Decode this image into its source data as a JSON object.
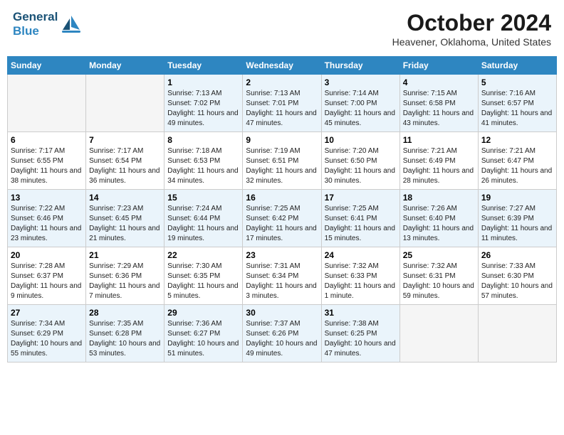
{
  "header": {
    "logo_line1": "General",
    "logo_line2": "Blue",
    "month": "October 2024",
    "location": "Heavener, Oklahoma, United States"
  },
  "days_of_week": [
    "Sunday",
    "Monday",
    "Tuesday",
    "Wednesday",
    "Thursday",
    "Friday",
    "Saturday"
  ],
  "weeks": [
    [
      {
        "day": "",
        "sunrise": "",
        "sunset": "",
        "daylight": ""
      },
      {
        "day": "",
        "sunrise": "",
        "sunset": "",
        "daylight": ""
      },
      {
        "day": "1",
        "sunrise": "Sunrise: 7:13 AM",
        "sunset": "Sunset: 7:02 PM",
        "daylight": "Daylight: 11 hours and 49 minutes."
      },
      {
        "day": "2",
        "sunrise": "Sunrise: 7:13 AM",
        "sunset": "Sunset: 7:01 PM",
        "daylight": "Daylight: 11 hours and 47 minutes."
      },
      {
        "day": "3",
        "sunrise": "Sunrise: 7:14 AM",
        "sunset": "Sunset: 7:00 PM",
        "daylight": "Daylight: 11 hours and 45 minutes."
      },
      {
        "day": "4",
        "sunrise": "Sunrise: 7:15 AM",
        "sunset": "Sunset: 6:58 PM",
        "daylight": "Daylight: 11 hours and 43 minutes."
      },
      {
        "day": "5",
        "sunrise": "Sunrise: 7:16 AM",
        "sunset": "Sunset: 6:57 PM",
        "daylight": "Daylight: 11 hours and 41 minutes."
      }
    ],
    [
      {
        "day": "6",
        "sunrise": "Sunrise: 7:17 AM",
        "sunset": "Sunset: 6:55 PM",
        "daylight": "Daylight: 11 hours and 38 minutes."
      },
      {
        "day": "7",
        "sunrise": "Sunrise: 7:17 AM",
        "sunset": "Sunset: 6:54 PM",
        "daylight": "Daylight: 11 hours and 36 minutes."
      },
      {
        "day": "8",
        "sunrise": "Sunrise: 7:18 AM",
        "sunset": "Sunset: 6:53 PM",
        "daylight": "Daylight: 11 hours and 34 minutes."
      },
      {
        "day": "9",
        "sunrise": "Sunrise: 7:19 AM",
        "sunset": "Sunset: 6:51 PM",
        "daylight": "Daylight: 11 hours and 32 minutes."
      },
      {
        "day": "10",
        "sunrise": "Sunrise: 7:20 AM",
        "sunset": "Sunset: 6:50 PM",
        "daylight": "Daylight: 11 hours and 30 minutes."
      },
      {
        "day": "11",
        "sunrise": "Sunrise: 7:21 AM",
        "sunset": "Sunset: 6:49 PM",
        "daylight": "Daylight: 11 hours and 28 minutes."
      },
      {
        "day": "12",
        "sunrise": "Sunrise: 7:21 AM",
        "sunset": "Sunset: 6:47 PM",
        "daylight": "Daylight: 11 hours and 26 minutes."
      }
    ],
    [
      {
        "day": "13",
        "sunrise": "Sunrise: 7:22 AM",
        "sunset": "Sunset: 6:46 PM",
        "daylight": "Daylight: 11 hours and 23 minutes."
      },
      {
        "day": "14",
        "sunrise": "Sunrise: 7:23 AM",
        "sunset": "Sunset: 6:45 PM",
        "daylight": "Daylight: 11 hours and 21 minutes."
      },
      {
        "day": "15",
        "sunrise": "Sunrise: 7:24 AM",
        "sunset": "Sunset: 6:44 PM",
        "daylight": "Daylight: 11 hours and 19 minutes."
      },
      {
        "day": "16",
        "sunrise": "Sunrise: 7:25 AM",
        "sunset": "Sunset: 6:42 PM",
        "daylight": "Daylight: 11 hours and 17 minutes."
      },
      {
        "day": "17",
        "sunrise": "Sunrise: 7:25 AM",
        "sunset": "Sunset: 6:41 PM",
        "daylight": "Daylight: 11 hours and 15 minutes."
      },
      {
        "day": "18",
        "sunrise": "Sunrise: 7:26 AM",
        "sunset": "Sunset: 6:40 PM",
        "daylight": "Daylight: 11 hours and 13 minutes."
      },
      {
        "day": "19",
        "sunrise": "Sunrise: 7:27 AM",
        "sunset": "Sunset: 6:39 PM",
        "daylight": "Daylight: 11 hours and 11 minutes."
      }
    ],
    [
      {
        "day": "20",
        "sunrise": "Sunrise: 7:28 AM",
        "sunset": "Sunset: 6:37 PM",
        "daylight": "Daylight: 11 hours and 9 minutes."
      },
      {
        "day": "21",
        "sunrise": "Sunrise: 7:29 AM",
        "sunset": "Sunset: 6:36 PM",
        "daylight": "Daylight: 11 hours and 7 minutes."
      },
      {
        "day": "22",
        "sunrise": "Sunrise: 7:30 AM",
        "sunset": "Sunset: 6:35 PM",
        "daylight": "Daylight: 11 hours and 5 minutes."
      },
      {
        "day": "23",
        "sunrise": "Sunrise: 7:31 AM",
        "sunset": "Sunset: 6:34 PM",
        "daylight": "Daylight: 11 hours and 3 minutes."
      },
      {
        "day": "24",
        "sunrise": "Sunrise: 7:32 AM",
        "sunset": "Sunset: 6:33 PM",
        "daylight": "Daylight: 11 hours and 1 minute."
      },
      {
        "day": "25",
        "sunrise": "Sunrise: 7:32 AM",
        "sunset": "Sunset: 6:31 PM",
        "daylight": "Daylight: 10 hours and 59 minutes."
      },
      {
        "day": "26",
        "sunrise": "Sunrise: 7:33 AM",
        "sunset": "Sunset: 6:30 PM",
        "daylight": "Daylight: 10 hours and 57 minutes."
      }
    ],
    [
      {
        "day": "27",
        "sunrise": "Sunrise: 7:34 AM",
        "sunset": "Sunset: 6:29 PM",
        "daylight": "Daylight: 10 hours and 55 minutes."
      },
      {
        "day": "28",
        "sunrise": "Sunrise: 7:35 AM",
        "sunset": "Sunset: 6:28 PM",
        "daylight": "Daylight: 10 hours and 53 minutes."
      },
      {
        "day": "29",
        "sunrise": "Sunrise: 7:36 AM",
        "sunset": "Sunset: 6:27 PM",
        "daylight": "Daylight: 10 hours and 51 minutes."
      },
      {
        "day": "30",
        "sunrise": "Sunrise: 7:37 AM",
        "sunset": "Sunset: 6:26 PM",
        "daylight": "Daylight: 10 hours and 49 minutes."
      },
      {
        "day": "31",
        "sunrise": "Sunrise: 7:38 AM",
        "sunset": "Sunset: 6:25 PM",
        "daylight": "Daylight: 10 hours and 47 minutes."
      },
      {
        "day": "",
        "sunrise": "",
        "sunset": "",
        "daylight": ""
      },
      {
        "day": "",
        "sunrise": "",
        "sunset": "",
        "daylight": ""
      }
    ]
  ]
}
